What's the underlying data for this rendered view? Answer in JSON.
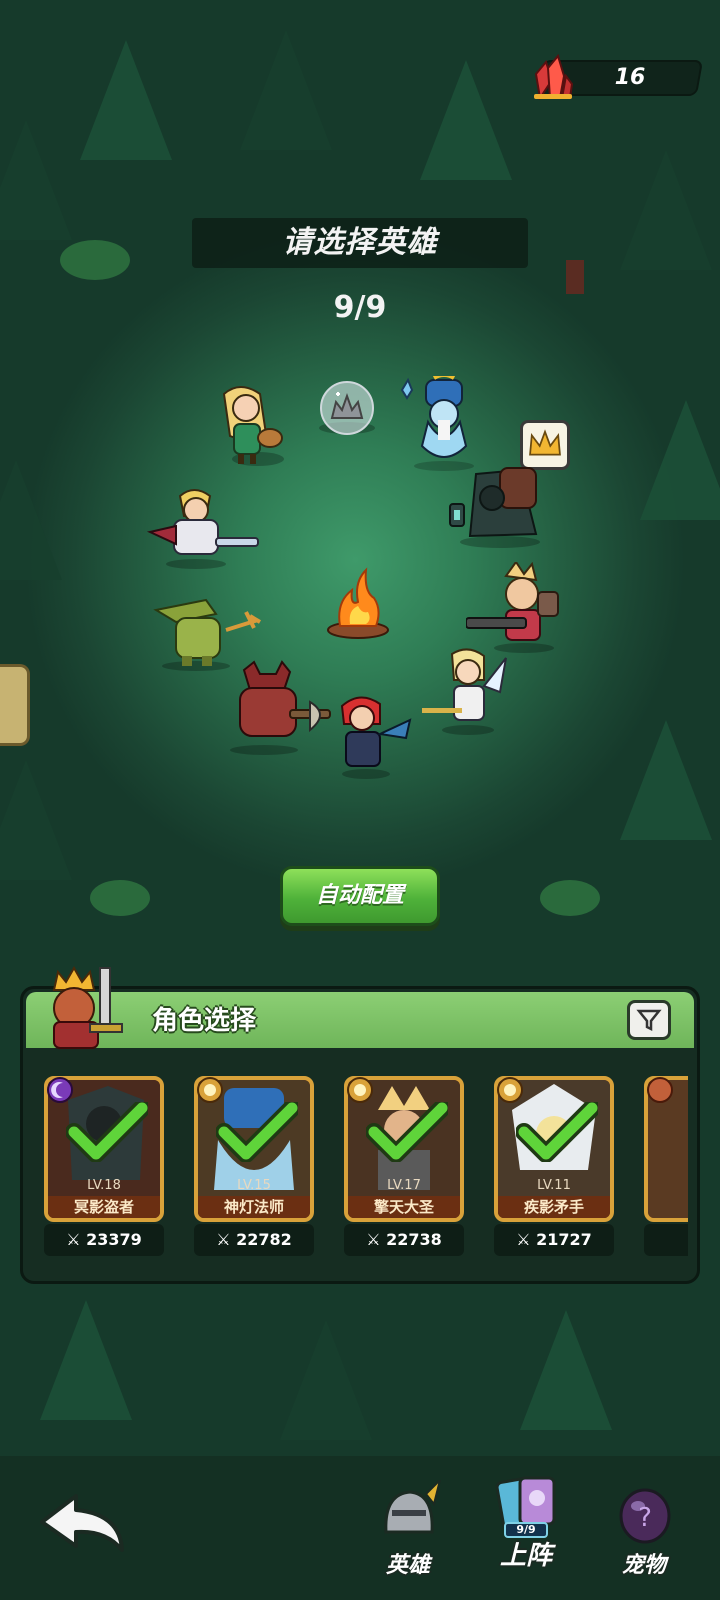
{
  "header": {
    "currency": {
      "icon": "red-crystal-icon",
      "value": "16"
    },
    "title": "请选择英雄",
    "selected_count": "9/9"
  },
  "scene": {
    "auto_button_label": "自动配置",
    "center_prop": "campfire",
    "leader_marker": "crown-icon"
  },
  "panel": {
    "title": "角色选择",
    "filter_icon": "filter-icon",
    "cards": [
      {
        "name": "冥影盗者",
        "level": "LV.18",
        "power": "23379",
        "element": "moon-icon",
        "selected": true
      },
      {
        "name": "神灯法师",
        "level": "LV.15",
        "power": "22782",
        "element": "sun-icon",
        "selected": true
      },
      {
        "name": "擎天大圣",
        "level": "LV.17",
        "power": "22738",
        "element": "sun-icon",
        "selected": true
      },
      {
        "name": "疾影矛手",
        "level": "LV.11",
        "power": "21727",
        "element": "sun-icon",
        "selected": true
      }
    ]
  },
  "nav": {
    "back_icon": "back-arrow-icon",
    "items": [
      {
        "label": "英雄",
        "icon": "knight-helmet-icon"
      },
      {
        "label": "上阵",
        "icon": "formation-cards-icon",
        "badge": "9/9",
        "active": true
      },
      {
        "label": "宠物",
        "icon": "pet-egg-icon"
      }
    ]
  },
  "colors": {
    "accent_green": "#4fb23a",
    "panel_header": "#8ccf74",
    "card_border": "#d9a23a",
    "check_green": "#5fd43a"
  }
}
